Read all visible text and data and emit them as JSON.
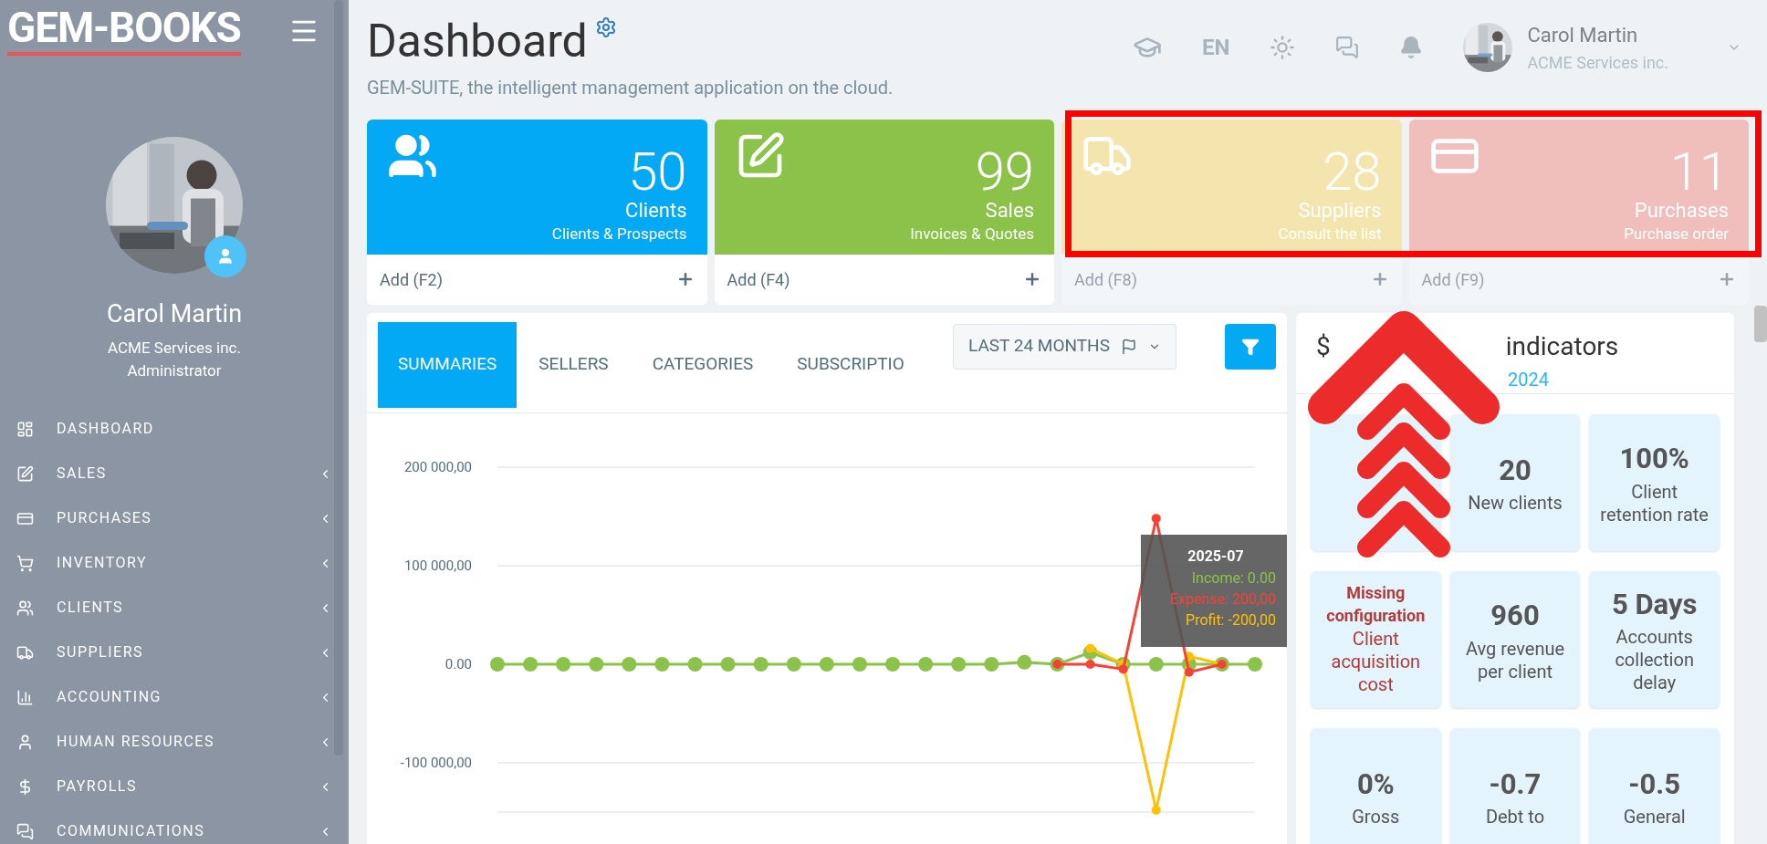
{
  "brand": {
    "logo": "GEM-BOOKS"
  },
  "profile": {
    "name": "Carol Martin",
    "company": "ACME Services inc.",
    "role": "Administrator"
  },
  "menu": [
    {
      "label": "DASHBOARD",
      "has_submenu": false
    },
    {
      "label": "SALES",
      "has_submenu": true
    },
    {
      "label": "PURCHASES",
      "has_submenu": true
    },
    {
      "label": "INVENTORY",
      "has_submenu": true
    },
    {
      "label": "CLIENTS",
      "has_submenu": true
    },
    {
      "label": "SUPPLIERS",
      "has_submenu": true
    },
    {
      "label": "ACCOUNTING",
      "has_submenu": true
    },
    {
      "label": "HUMAN RESOURCES",
      "has_submenu": true
    },
    {
      "label": "PAYROLLS",
      "has_submenu": true
    },
    {
      "label": "COMMUNICATIONS",
      "has_submenu": true
    }
  ],
  "header": {
    "title": "Dashboard",
    "subtitle": "GEM-SUITE, the intelligent management application on the cloud.",
    "language": "EN",
    "user_name": "Carol Martin",
    "user_company": "ACME Services inc."
  },
  "cards": [
    {
      "value": "50",
      "title": "Clients",
      "subtitle": "Clients & Prospects",
      "action": "Add (F2)",
      "color": "#03a9f4",
      "highlighted": false
    },
    {
      "value": "99",
      "title": "Sales",
      "subtitle": "Invoices & Quotes",
      "action": "Add (F4)",
      "color": "#8bc34a",
      "highlighted": false
    },
    {
      "value": "28",
      "title": "Suppliers",
      "subtitle": "Consult the list",
      "action": "Add (F8)",
      "color": "#f3e5ad",
      "highlighted": true
    },
    {
      "value": "11",
      "title": "Purchases",
      "subtitle": "Purchase order",
      "action": "Add (F9)",
      "color": "#f1bfbb",
      "highlighted": true
    }
  ],
  "chart_panel": {
    "tabs": [
      {
        "label": "SUMMARIES",
        "selected": true
      },
      {
        "label": "SELLERS",
        "selected": false
      },
      {
        "label": "CATEGORIES",
        "selected": false
      },
      {
        "label": "SUBSCRIPTIO",
        "selected": false
      }
    ],
    "period": "LAST 24 MONTHS",
    "chart_data": {
      "type": "line",
      "grid": true,
      "ylim": [
        -150000,
        200000
      ],
      "yticks": [
        {
          "value": -100000,
          "label": "-100 000,00"
        },
        {
          "value": 0,
          "label": "0.00"
        },
        {
          "value": 100000,
          "label": "100 000,00"
        },
        {
          "value": 200000,
          "label": "200 000,00"
        }
      ],
      "series": [
        {
          "color": "#8bc34a",
          "marker": true,
          "values": [
            0,
            0,
            0,
            0,
            0,
            0,
            0,
            0,
            0,
            0,
            0,
            0,
            0,
            0,
            0,
            0,
            2000,
            0,
            12000,
            0,
            0,
            0,
            0,
            0
          ]
        },
        {
          "color": "#ffc107",
          "marker": true,
          "values": [
            null,
            null,
            null,
            null,
            null,
            null,
            null,
            null,
            null,
            null,
            null,
            null,
            null,
            null,
            null,
            null,
            null,
            null,
            16000,
            0,
            -148000,
            8000,
            0,
            null
          ]
        },
        {
          "color": "#f44336",
          "marker": true,
          "values": [
            null,
            null,
            null,
            null,
            null,
            null,
            null,
            null,
            null,
            null,
            null,
            null,
            null,
            null,
            null,
            null,
            null,
            0,
            0,
            -5000,
            148000,
            -8000,
            0,
            null
          ]
        }
      ]
    },
    "tooltip": {
      "title": "2025-07",
      "lines": [
        {
          "text": "Income: 0.00",
          "color": "#8bc34a"
        },
        {
          "text": "Expense: 200,00",
          "color": "#f44336"
        },
        {
          "text": "Profit: -200,00",
          "color": "#ffc107"
        }
      ]
    }
  },
  "indicators": {
    "title_start": "$",
    "title_end": "indicators",
    "subtitle": "2024",
    "tiles": [
      {
        "kind": "covered"
      },
      {
        "kind": "metric",
        "value": "20",
        "label": "New clients"
      },
      {
        "kind": "metric",
        "value": "100%",
        "label": "Client retention rate"
      },
      {
        "kind": "warning",
        "value": "Missing configuration",
        "label": "Client acquisition cost"
      },
      {
        "kind": "metric",
        "value": "960",
        "label": "Avg revenue per client"
      },
      {
        "kind": "metric",
        "value": "5 Days",
        "label": "Accounts collection delay"
      },
      {
        "kind": "metric",
        "value": "0%",
        "label": "Gross"
      },
      {
        "kind": "metric",
        "value": "-0.7",
        "label": "Debt to"
      },
      {
        "kind": "metric",
        "value": "-0.5",
        "label": "General"
      }
    ]
  }
}
